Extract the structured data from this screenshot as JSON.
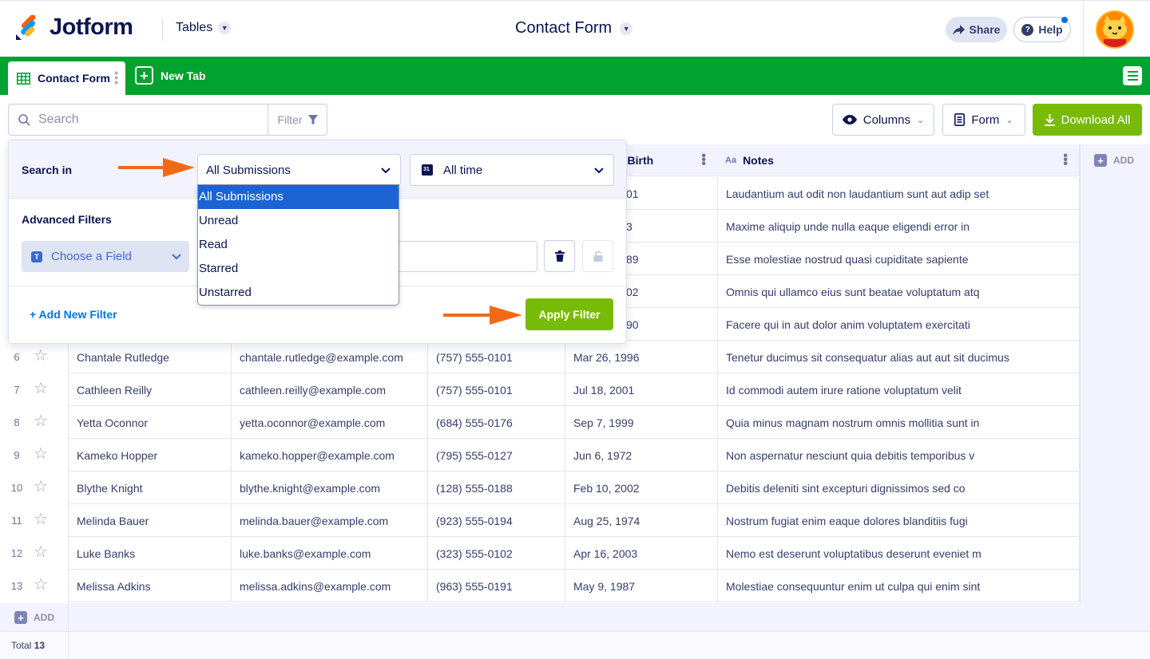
{
  "header": {
    "brand": "Jotform",
    "tables_label": "Tables",
    "form_title": "Contact Form",
    "share_label": "Share",
    "help_label": "Help"
  },
  "tabs": {
    "active_label": "Contact Form",
    "new_tab_label": "New Tab"
  },
  "toolbar": {
    "search_placeholder": "Search",
    "filter_label": "Filter",
    "columns_label": "Columns",
    "form_label": "Form",
    "download_label": "Download All"
  },
  "table": {
    "visible_headers": [
      {
        "label": "f Birth"
      },
      {
        "label": "Notes",
        "icon": "Aa"
      }
    ],
    "add_column_label": "ADD",
    "add_row_label": "ADD",
    "total_label": "Total",
    "total_count": "13",
    "partial_rows": [
      {
        "dob": "01",
        "notes": "Laudantium aut odit non laudantium sunt aut adip set"
      },
      {
        "dob": "3",
        "notes": "Maxime aliquip unde nulla eaque eligendi error in"
      },
      {
        "dob": "89",
        "notes": "Esse molestiae nostrud quasi cupiditate sapiente"
      },
      {
        "dob": "02",
        "notes": "Omnis qui ullamco eius sunt beatae voluptatum atq"
      },
      {
        "dob": "90",
        "notes": "Facere qui in aut dolor anim voluptatem exercitati"
      }
    ],
    "rows": [
      {
        "num": "6",
        "name": "Chantale Rutledge",
        "email": "chantale.rutledge@example.com",
        "phone": "(757) 555-0101",
        "dob": "Mar 26, 1996",
        "notes": "Tenetur ducimus sit consequatur alias aut aut sit ducimus"
      },
      {
        "num": "7",
        "name": "Cathleen Reilly",
        "email": "cathleen.reilly@example.com",
        "phone": "(757) 555-0101",
        "dob": "Jul 18, 2001",
        "notes": "Id commodi autem irure ratione voluptatum velit"
      },
      {
        "num": "8",
        "name": "Yetta Oconnor",
        "email": "yetta.oconnor@example.com",
        "phone": "(684) 555-0176",
        "dob": "Sep 7, 1999",
        "notes": "Quia minus magnam nostrum omnis mollitia sunt in"
      },
      {
        "num": "9",
        "name": "Kameko Hopper",
        "email": "kameko.hopper@example.com",
        "phone": "(795) 555-0127",
        "dob": "Jun 6, 1972",
        "notes": "Non aspernatur nesciunt quia debitis temporibus v"
      },
      {
        "num": "10",
        "name": "Blythe Knight",
        "email": "blythe.knight@example.com",
        "phone": "(128) 555-0188",
        "dob": "Feb 10, 2002",
        "notes": "Debitis deleniti sint excepturi dignissimos sed co"
      },
      {
        "num": "11",
        "name": "Melinda Bauer",
        "email": "melinda.bauer@example.com",
        "phone": "(923) 555-0194",
        "dob": "Aug 25, 1974",
        "notes": "Nostrum fugiat enim eaque dolores blanditiis fugi"
      },
      {
        "num": "12",
        "name": "Luke Banks",
        "email": "luke.banks@example.com",
        "phone": "(323) 555-0102",
        "dob": "Apr 16, 2003",
        "notes": "Nemo est deserunt voluptatibus deserunt eveniet m"
      },
      {
        "num": "13",
        "name": "Melissa Adkins",
        "email": "melissa.adkins@example.com",
        "phone": "(963) 555-0191",
        "dob": "May 9, 1987",
        "notes": "Molestiae consequuntur enim ut culpa qui enim sint"
      }
    ]
  },
  "filter_panel": {
    "search_in_label": "Search in",
    "submissions_value": "All Submissions",
    "time_value": "All time",
    "advanced_label": "Advanced Filters",
    "choose_field_label": "Choose a Field",
    "add_filter_label": "+ Add New Filter",
    "apply_label": "Apply Filter",
    "dropdown_options": [
      "All Submissions",
      "Unread",
      "Read",
      "Starred",
      "Unstarred"
    ],
    "selected_option": "All Submissions"
  },
  "colors": {
    "brand_green": "#01a22f",
    "action_green": "#78bb07",
    "navy": "#0a1551",
    "selected_blue": "#1c64d3",
    "arrow_orange": "#f26a16"
  }
}
